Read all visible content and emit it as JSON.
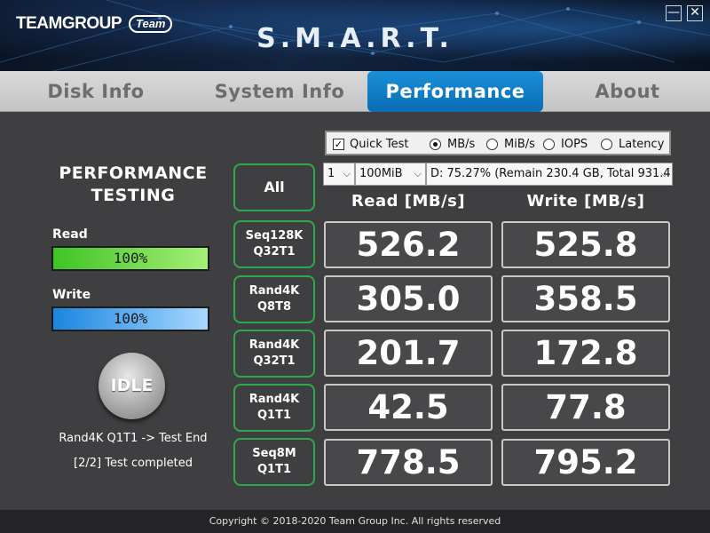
{
  "header": {
    "logo_text": "TEAMGROUP",
    "logo_badge": "Team",
    "app_title": "S.M.A.R.T.",
    "minimize_label": "—",
    "close_label": "✕"
  },
  "tabs": [
    {
      "label": "Disk Info",
      "active": false
    },
    {
      "label": "System Info",
      "active": false
    },
    {
      "label": "Performance",
      "active": true
    },
    {
      "label": "About",
      "active": false
    }
  ],
  "left_panel": {
    "title_line1": "PERFORMANCE",
    "title_line2": "TESTING",
    "read_label": "Read",
    "read_progress_text": "100%",
    "read_progress": 1.0,
    "write_label": "Write",
    "write_progress_text": "100%",
    "write_progress": 1.0,
    "idle_label": "IDLE",
    "status_line1": "Rand4K Q1T1 -> Test End",
    "status_line2": "[2/2] Test completed"
  },
  "options": {
    "quick_test_label": "Quick Test",
    "quick_test_checked": true,
    "units": [
      {
        "label": "MB/s",
        "selected": true
      },
      {
        "label": "MiB/s",
        "selected": false
      },
      {
        "label": "IOPS",
        "selected": false
      },
      {
        "label": "Latency",
        "selected": false
      }
    ],
    "count_value": "1",
    "size_value": "100MiB",
    "drive_value": "D: 75.27% (Remain 230.4 GB, Total 931.4"
  },
  "table": {
    "all_label": "All",
    "read_header": "Read [MB/s]",
    "write_header": "Write [MB/s]",
    "rows": [
      {
        "line1": "Seq128K",
        "line2": "Q32T1",
        "read": "526.2",
        "write": "525.8"
      },
      {
        "line1": "Rand4K",
        "line2": "Q8T8",
        "read": "305.0",
        "write": "358.5"
      },
      {
        "line1": "Rand4K",
        "line2": "Q32T1",
        "read": "201.7",
        "write": "172.8"
      },
      {
        "line1": "Rand4K",
        "line2": "Q1T1",
        "read": "42.5",
        "write": "77.8"
      },
      {
        "line1": "Seq8M",
        "line2": "Q1T1",
        "read": "778.5",
        "write": "795.2"
      }
    ]
  },
  "footer": {
    "copyright": "Copyright © 2018-2020 Team Group Inc. All rights reserved"
  },
  "colors": {
    "accent_blue": "#0a6db4",
    "button_border_green": "#2ea84a",
    "read_bar_green": "#3fc425",
    "write_bar_blue": "#1a86e0",
    "background": "#3f3f42"
  }
}
